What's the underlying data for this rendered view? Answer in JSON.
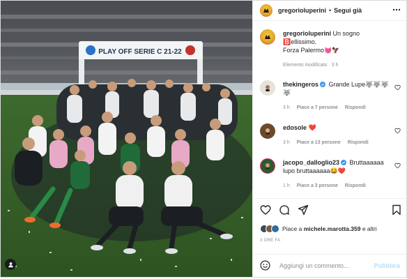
{
  "post": {
    "author": "gregorioluperini",
    "follow_label": "Segui già",
    "separator": "•",
    "photo": {
      "banner_text": "PLAY OFF SERIE C 21-22"
    },
    "caption": {
      "username": "gregorioluperini",
      "text_line1": "Un sogno",
      "text_line2": "🅱️ellissimo.",
      "text_line3": "Forza Palermo💓🦅",
      "meta": "Elemento modificato · 3 h"
    },
    "comments": [
      {
        "username": "thekingeros",
        "verified": true,
        "text": "Grande Lupe🐺🐺🐺🐺",
        "time": "3 h",
        "likes": "Piace a 7 persone",
        "reply": "Rispondi",
        "avatar_color": "#e9e2da"
      },
      {
        "username": "edosole",
        "verified": false,
        "text": "❤️",
        "time": "3 h",
        "likes": "Piace a 13 persone",
        "reply": "Rispondi",
        "avatar_color": "#6b4a2c"
      },
      {
        "username": "jacopo_dalloglio23",
        "verified": true,
        "text_line1": "Bruttaaaaaa",
        "text_line2": "lupo bruttaaaaaa😂❤️",
        "time": "1 h",
        "likes": "Piace a 3 persone",
        "reply": "Rispondi",
        "avatar_color": "#2b5b2f"
      }
    ],
    "likes": {
      "prefix": "Piace a ",
      "user": "michele.marotta.359",
      "suffix": " e altri"
    },
    "date": "3 ORE FA",
    "add_comment": {
      "placeholder": "Aggiungi un commento...",
      "publish": "Pubblica"
    },
    "icons": {
      "more": "more-icon",
      "like": "heart-icon",
      "comment": "comment-icon",
      "share": "share-icon",
      "save": "bookmark-icon",
      "emoji": "emoji-icon",
      "user_tag": "user-tag-icon"
    },
    "colors": {
      "publish_disabled": "#b2dffc",
      "verified": "#3897f0",
      "heart_red": "#ed4956",
      "meta_gray": "#8e8e8e"
    }
  }
}
